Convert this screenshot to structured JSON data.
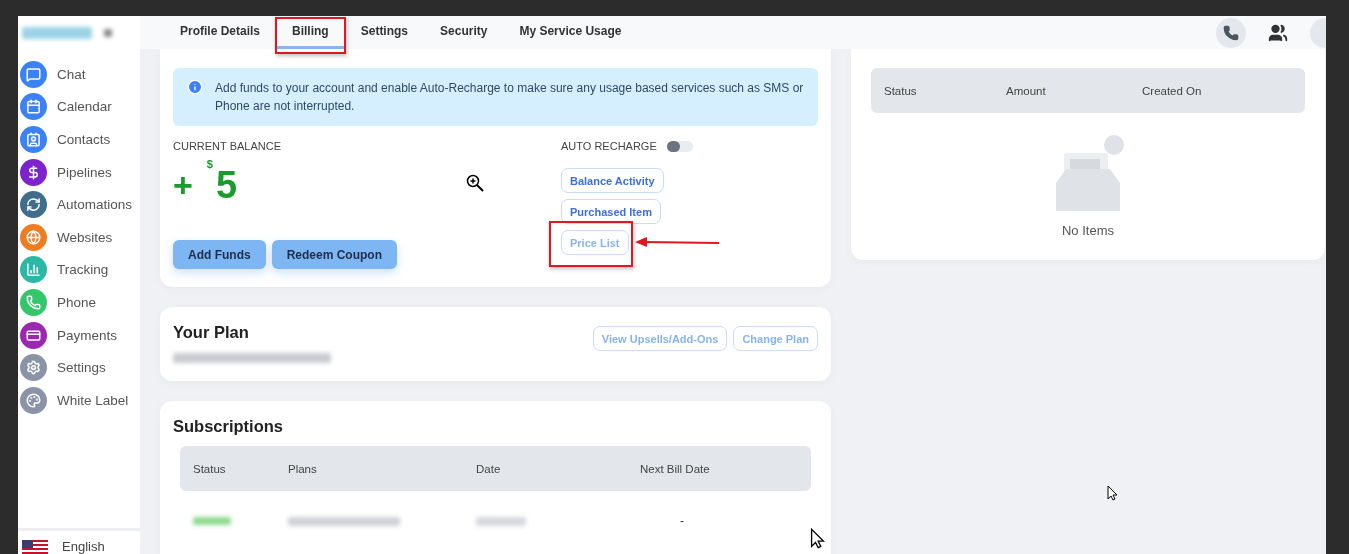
{
  "sidebar": {
    "items": [
      {
        "label": "Chat",
        "color": "#3b82f6"
      },
      {
        "label": "Calendar",
        "color": "#3b82f6"
      },
      {
        "label": "Contacts",
        "color": "#3b82f6"
      },
      {
        "label": "Pipelines",
        "color": "#7e22ce"
      },
      {
        "label": "Automations",
        "color": "#3f6e8c"
      },
      {
        "label": "Websites",
        "color": "#f07c21"
      },
      {
        "label": "Tracking",
        "color": "#2cb8a6"
      },
      {
        "label": "Phone",
        "color": "#34c66a"
      },
      {
        "label": "Payments",
        "color": "#9c27b0"
      },
      {
        "label": "Settings",
        "color": "#8a94a6"
      },
      {
        "label": "White Label",
        "color": "#8a94a6"
      }
    ],
    "language": "English"
  },
  "tabs": [
    {
      "label": "Profile Details",
      "selected": false,
      "annotated": false
    },
    {
      "label": "Billing",
      "selected": true,
      "annotated": true
    },
    {
      "label": "Settings",
      "selected": false,
      "annotated": false
    },
    {
      "label": "Security",
      "selected": false,
      "annotated": false
    },
    {
      "label": "My Service Usage",
      "selected": false,
      "annotated": false
    }
  ],
  "billing": {
    "notice": "Add funds to your account and enable Auto-Recharge to make sure any usage based services such as SMS or Phone are not interrupted.",
    "balance_label": "CURRENT BALANCE",
    "sign": "+",
    "currency": "$",
    "amount": "5",
    "actions": [
      "Add Funds",
      "Redeem Coupon"
    ],
    "auto_recharge": {
      "label": "AUTO RECHARGE",
      "on": false
    },
    "links": [
      {
        "label": "Balance Activity",
        "annotated": false
      },
      {
        "label": "Purchased Item",
        "annotated": false
      },
      {
        "label": "Price List",
        "annotated": true
      }
    ]
  },
  "plan": {
    "title": "Your Plan",
    "actions": [
      "View Upsells/Add-Ons",
      "Change Plan"
    ]
  },
  "subscriptions": {
    "title": "Subscriptions",
    "columns": [
      "Status",
      "Plans",
      "Date",
      "Next Bill Date"
    ],
    "rows": [
      {
        "next_bill_date": "-"
      }
    ]
  },
  "transactions": {
    "columns": [
      "Status",
      "Amount",
      "Created On"
    ],
    "empty": "No Items"
  }
}
